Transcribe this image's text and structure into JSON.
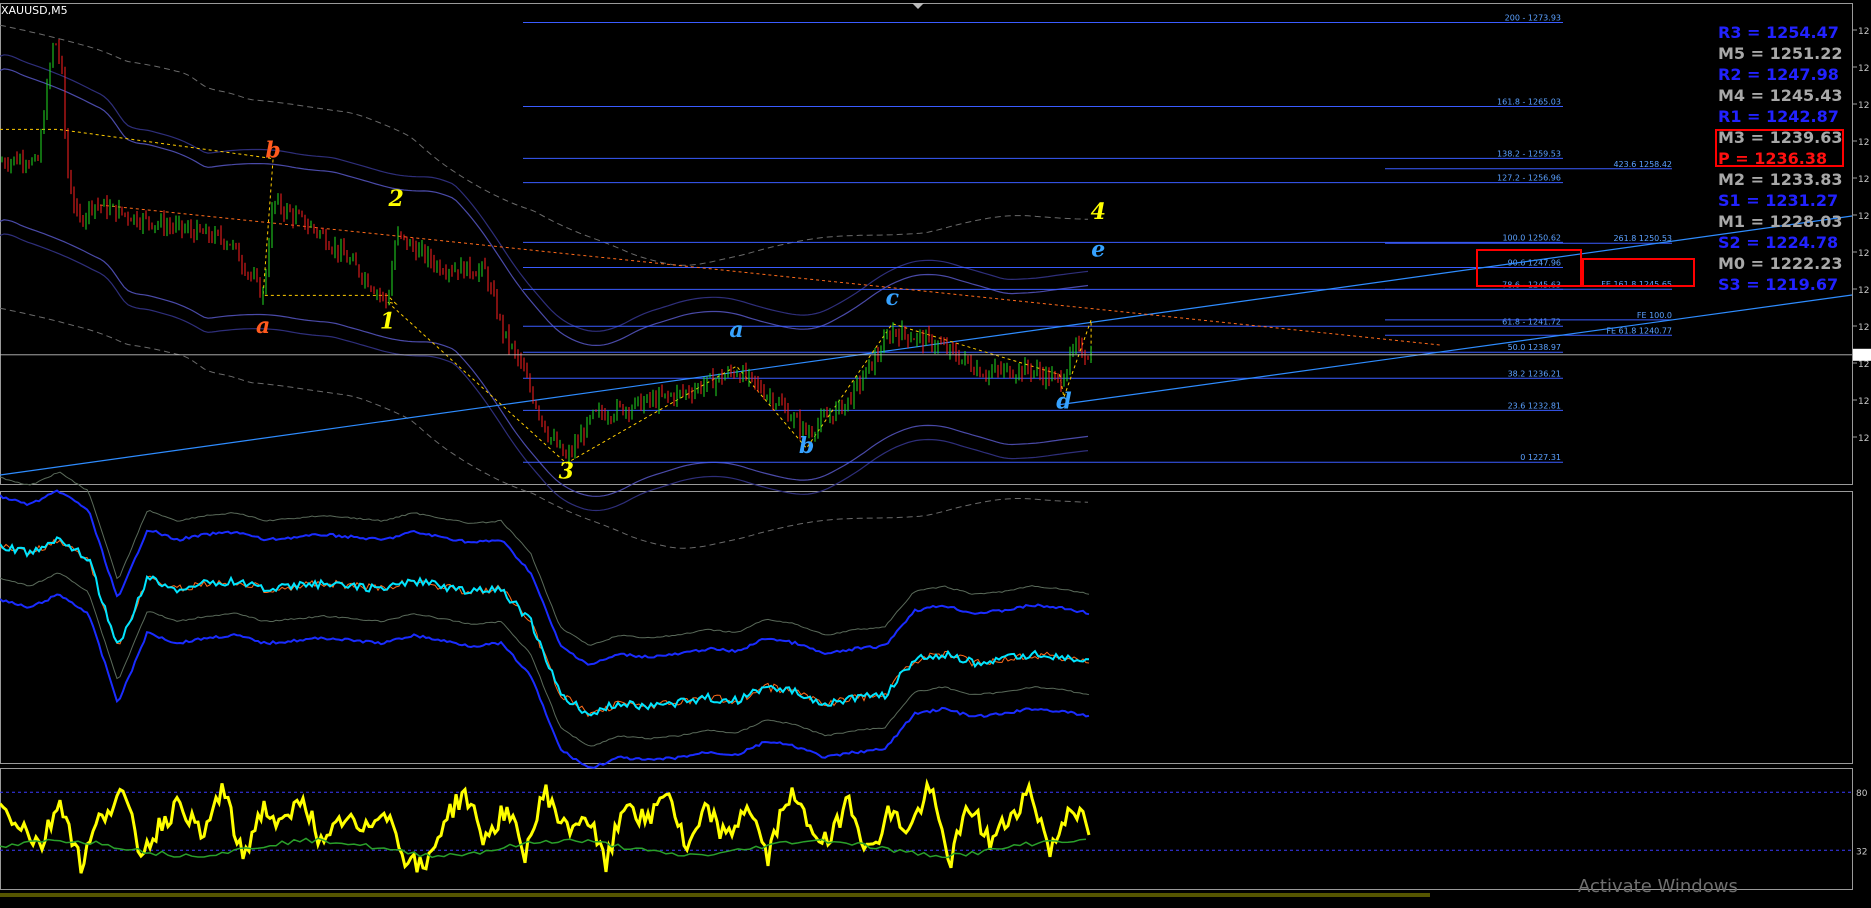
{
  "symbol": "XAUUSD,M5",
  "watermark": "Activate Windows",
  "colors": {
    "background": "#000000",
    "bull_candle": "#22dd22",
    "bear_candle": "#ff2020",
    "fib_line": "#3a5cff",
    "fib_label": "#5aa0ff",
    "trend_line": "#2e8cff",
    "resistance": "#2222ff",
    "pivot": "#ff1010",
    "mid": "#a8a8a8",
    "rsi": "#ffff00",
    "highlight_box": "#ff0000"
  },
  "pivots": [
    {
      "label": "R3 = 1254.47",
      "kind": "res"
    },
    {
      "label": "M5 = 1251.22",
      "kind": "mid"
    },
    {
      "label": "R2 = 1247.98",
      "kind": "res"
    },
    {
      "label": "M4 = 1245.43",
      "kind": "mid"
    },
    {
      "label": "R1 = 1242.87",
      "kind": "res"
    },
    {
      "label": "M3 = 1239.63",
      "kind": "mid"
    },
    {
      "label": "P  = 1236.38",
      "kind": "pv"
    },
    {
      "label": "M2 = 1233.83",
      "kind": "mid"
    },
    {
      "label": "S1 = 1231.27",
      "kind": "res"
    },
    {
      "label": "M1 = 1228.03",
      "kind": "mid"
    },
    {
      "label": "S2 = 1224.78",
      "kind": "res"
    },
    {
      "label": "M0 = 1222.23",
      "kind": "mid"
    },
    {
      "label": "S3 = 1219.67",
      "kind": "res"
    }
  ],
  "chart_data": [
    {
      "type": "candlestick",
      "title": "XAUUSD,M5",
      "ylim": [
        1225,
        1276
      ],
      "fib_retracement": [
        {
          "label": "200 - 1273.93",
          "value": 1273.93
        },
        {
          "label": "161.8 - 1265.03",
          "value": 1265.03
        },
        {
          "label": "138.2 - 1259.53",
          "value": 1259.53
        },
        {
          "label": "127.2 - 1256.96",
          "value": 1256.96
        },
        {
          "label": "100.0 1250.62",
          "value": 1250.62
        },
        {
          "label": "90.6 1247.96",
          "value": 1247.96
        },
        {
          "label": "78.6 - 1245.63",
          "value": 1245.63
        },
        {
          "label": "61.8 - 1241.72",
          "value": 1241.72
        },
        {
          "label": "50.0 1238.97",
          "value": 1238.97
        },
        {
          "label": "38.2 1236.21",
          "value": 1236.21
        },
        {
          "label": "23.6 1232.81",
          "value": 1232.81
        },
        {
          "label": "0 1227.31",
          "value": 1227.31
        }
      ],
      "fib_extension": [
        {
          "label": "423.6 1258.42",
          "value": 1258.42
        },
        {
          "label": "261.8 1250.53",
          "value": 1250.53
        },
        {
          "label": "FE 161.8 1245.65",
          "value": 1245.65
        },
        {
          "label": "FE 100.0",
          "value": 1242.4
        },
        {
          "label": "FE 61.8 1240.77",
          "value": 1240.77
        }
      ],
      "wave_labels": [
        {
          "text": "a",
          "color": "#ff5a1e",
          "time": 0.184,
          "price": 1241.0
        },
        {
          "text": "b",
          "color": "#ff5a1e",
          "time": 0.191,
          "price": 1259.6
        },
        {
          "text": "1",
          "color": "#ffff00",
          "time": 0.271,
          "price": 1241.5
        },
        {
          "text": "2",
          "color": "#ffff00",
          "time": 0.277,
          "price": 1254.5
        },
        {
          "text": "3",
          "color": "#ffff00",
          "time": 0.396,
          "price": 1225.6
        },
        {
          "text": "a",
          "color": "#36a2ff",
          "time": 0.515,
          "price": 1240.6
        },
        {
          "text": "b",
          "color": "#36a2ff",
          "time": 0.564,
          "price": 1228.3
        },
        {
          "text": "c",
          "color": "#36a2ff",
          "time": 0.624,
          "price": 1244.0
        },
        {
          "text": "4",
          "color": "#ffff00",
          "time": 0.768,
          "price": 1253.1
        },
        {
          "text": "e",
          "color": "#36a2ff",
          "time": 0.768,
          "price": 1249.1
        },
        {
          "text": "d",
          "color": "#36a2ff",
          "time": 0.744,
          "price": 1233.0
        }
      ],
      "swing_points": [
        1262.6,
        1262.6,
        1259.5,
        1245.0,
        1245.0,
        1244.1,
        1244.3,
        1227.2,
        1237.5,
        1228.8,
        1242.0,
        1236.6,
        1236.6,
        1234.2,
        1242.4,
        1238.1
      ],
      "price_path": [
        {
          "time": 0.0,
          "price": 1259.2
        },
        {
          "time": 0.019,
          "price": 1259.6
        },
        {
          "time": 0.026,
          "price": 1258.6
        },
        {
          "time": 0.032,
          "price": 1266.0
        },
        {
          "time": 0.038,
          "price": 1272.4
        },
        {
          "time": 0.043,
          "price": 1269.1
        },
        {
          "time": 0.047,
          "price": 1258.1
        },
        {
          "time": 0.055,
          "price": 1252.6
        },
        {
          "time": 0.064,
          "price": 1254.8
        },
        {
          "time": 0.096,
          "price": 1253.2
        },
        {
          "time": 0.128,
          "price": 1252.0
        },
        {
          "time": 0.16,
          "price": 1250.8
        },
        {
          "time": 0.184,
          "price": 1245.0
        },
        {
          "time": 0.191,
          "price": 1254.9
        },
        {
          "time": 0.224,
          "price": 1251.6
        },
        {
          "time": 0.255,
          "price": 1247.0
        },
        {
          "time": 0.271,
          "price": 1244.2
        },
        {
          "time": 0.277,
          "price": 1251.4
        },
        {
          "time": 0.307,
          "price": 1248.1
        },
        {
          "time": 0.339,
          "price": 1247.6
        },
        {
          "time": 0.352,
          "price": 1241.0
        },
        {
          "time": 0.364,
          "price": 1237.6
        },
        {
          "time": 0.383,
          "price": 1230.4
        },
        {
          "time": 0.396,
          "price": 1227.6
        },
        {
          "time": 0.415,
          "price": 1232.2
        },
        {
          "time": 0.447,
          "price": 1233.5
        },
        {
          "time": 0.479,
          "price": 1234.7
        },
        {
          "time": 0.515,
          "price": 1237.0
        },
        {
          "time": 0.543,
          "price": 1233.8
        },
        {
          "time": 0.564,
          "price": 1230.4
        },
        {
          "time": 0.592,
          "price": 1233.6
        },
        {
          "time": 0.609,
          "price": 1237.6
        },
        {
          "time": 0.624,
          "price": 1241.3
        },
        {
          "time": 0.656,
          "price": 1239.8
        },
        {
          "time": 0.688,
          "price": 1236.8
        },
        {
          "time": 0.72,
          "price": 1237.2
        },
        {
          "time": 0.741,
          "price": 1235.9
        },
        {
          "time": 0.752,
          "price": 1239.4
        },
        {
          "time": 0.763,
          "price": 1238.7
        }
      ]
    },
    {
      "type": "line",
      "series": [
        {
          "values": [
            0.2,
            0.23,
            0.18,
            0.25,
            0.58,
            0.32,
            0.36,
            0.34,
            0.33,
            0.36,
            0.35,
            0.34,
            0.35,
            0.36,
            0.33,
            0.35,
            0.37,
            0.36,
            0.48,
            0.75,
            0.82,
            0.78,
            0.79,
            0.78,
            0.76,
            0.77,
            0.72,
            0.74,
            0.78,
            0.76,
            0.75,
            0.62,
            0.6,
            0.63,
            0.62,
            0.6,
            0.61,
            0.63
          ]
        }
      ]
    },
    {
      "type": "line",
      "ylim": [
        0,
        100
      ],
      "series": [
        {
          "values": [
            68,
            55,
            35,
            75,
            20,
            60,
            80,
            30,
            55,
            72,
            40,
            85,
            25,
            68,
            50,
            78,
            32,
            60,
            45,
            70,
            28,
            15,
            58,
            80,
            40,
            66,
            30,
            82,
            48,
            62,
            20,
            75,
            52,
            85,
            30,
            66,
            40,
            72,
            25,
            80,
            55,
            35,
            78,
            28,
            64,
            48,
            84,
            22,
            70,
            38,
            60,
            82,
            30,
            72,
            45
          ]
        }
      ],
      "tick_labels": [
        "80",
        "32"
      ]
    }
  ]
}
